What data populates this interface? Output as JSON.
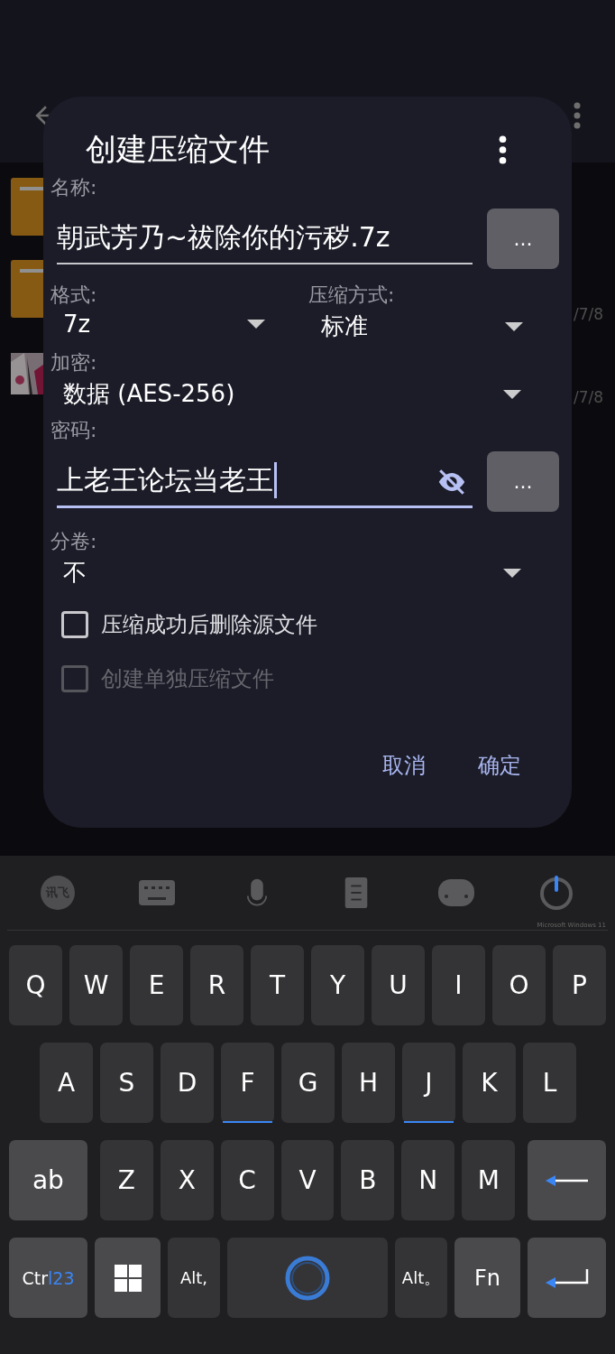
{
  "background_app": {
    "dates": [
      "/7/8",
      "/7/8"
    ]
  },
  "dialog": {
    "title": "创建压缩文件",
    "name_label": "名称:",
    "name_value": "朝武芳乃~祓除你的污秽.7z",
    "browse_button": "...",
    "format": {
      "label": "格式:",
      "value": "7z"
    },
    "method": {
      "label": "压缩方式:",
      "value": "标准"
    },
    "encryption": {
      "label": "加密:",
      "value": "数据 (AES-256)"
    },
    "password": {
      "label": "密码:",
      "value": "上老王论坛当老王",
      "focused": true,
      "browse_button": "..."
    },
    "split": {
      "label": "分卷:",
      "value": "不"
    },
    "checkboxes": [
      {
        "label": "压缩成功后删除源文件",
        "checked": false,
        "disabled": false
      },
      {
        "label": "创建单独压缩文件",
        "checked": false,
        "disabled": true
      }
    ],
    "buttons": [
      "取消",
      "确定"
    ]
  },
  "keyboard": {
    "logo": "讯飞",
    "watermark": "Microsoft Windows 11",
    "keys": [
      {
        "kind": "letter",
        "label": "Q"
      },
      {
        "kind": "letter",
        "label": "W"
      },
      {
        "kind": "letter",
        "label": "E"
      },
      {
        "kind": "letter",
        "label": "R"
      },
      {
        "kind": "letter",
        "label": "T"
      },
      {
        "kind": "letter",
        "label": "Y"
      },
      {
        "kind": "letter",
        "label": "U"
      },
      {
        "kind": "letter",
        "label": "I"
      },
      {
        "kind": "letter",
        "label": "O"
      },
      {
        "kind": "letter",
        "label": "P"
      },
      {
        "kind": "letter",
        "label": "A"
      },
      {
        "kind": "letter",
        "label": "S"
      },
      {
        "kind": "letter",
        "label": "D"
      },
      {
        "kind": "letter",
        "label": "F",
        "home": true
      },
      {
        "kind": "letter",
        "label": "G"
      },
      {
        "kind": "letter",
        "label": "H"
      },
      {
        "kind": "letter",
        "label": "J",
        "home": true
      },
      {
        "kind": "letter",
        "label": "K"
      },
      {
        "kind": "letter",
        "label": "L"
      },
      {
        "kind": "wide",
        "label": "ab"
      },
      {
        "kind": "letter",
        "label": "Z"
      },
      {
        "kind": "letter",
        "label": "X"
      },
      {
        "kind": "letter",
        "label": "C"
      },
      {
        "kind": "letter",
        "label": "V"
      },
      {
        "kind": "letter",
        "label": "B"
      },
      {
        "kind": "letter",
        "label": "N"
      },
      {
        "kind": "letter",
        "label": "M"
      },
      {
        "kind": "backspace"
      },
      {
        "kind": "wide",
        "label": "Ctr",
        "accent": "l23"
      },
      {
        "kind": "windows"
      },
      {
        "kind": "alt",
        "label": "Alt,"
      },
      {
        "kind": "space"
      },
      {
        "kind": "alt",
        "label": "Alt。"
      },
      {
        "kind": "fn",
        "label": "Fn"
      },
      {
        "kind": "enter"
      }
    ]
  }
}
